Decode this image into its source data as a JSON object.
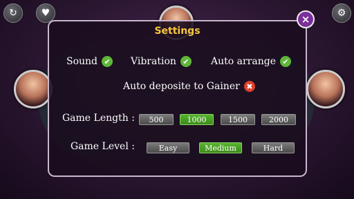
{
  "settings": {
    "title": "Settings",
    "options": {
      "sound": {
        "label": "Sound",
        "checked": true
      },
      "vibration": {
        "label": "Vibration",
        "checked": true
      },
      "auto_arrange": {
        "label": "Auto arrange",
        "checked": true
      },
      "auto_deposite": {
        "label": "Auto deposite to Gainer",
        "checked": false
      }
    },
    "game_length": {
      "label": "Game Length :",
      "options": [
        "500",
        "1000",
        "1500",
        "2000"
      ],
      "selected": "1000"
    },
    "game_level": {
      "label": "Game Level :",
      "options": [
        "Easy",
        "Medium",
        "Hard"
      ],
      "selected": "Medium"
    }
  },
  "glyphs": {
    "close": "×",
    "check": "✔",
    "cross": "✖",
    "refresh": "↻",
    "heart": "♥",
    "gear": "⚙"
  }
}
